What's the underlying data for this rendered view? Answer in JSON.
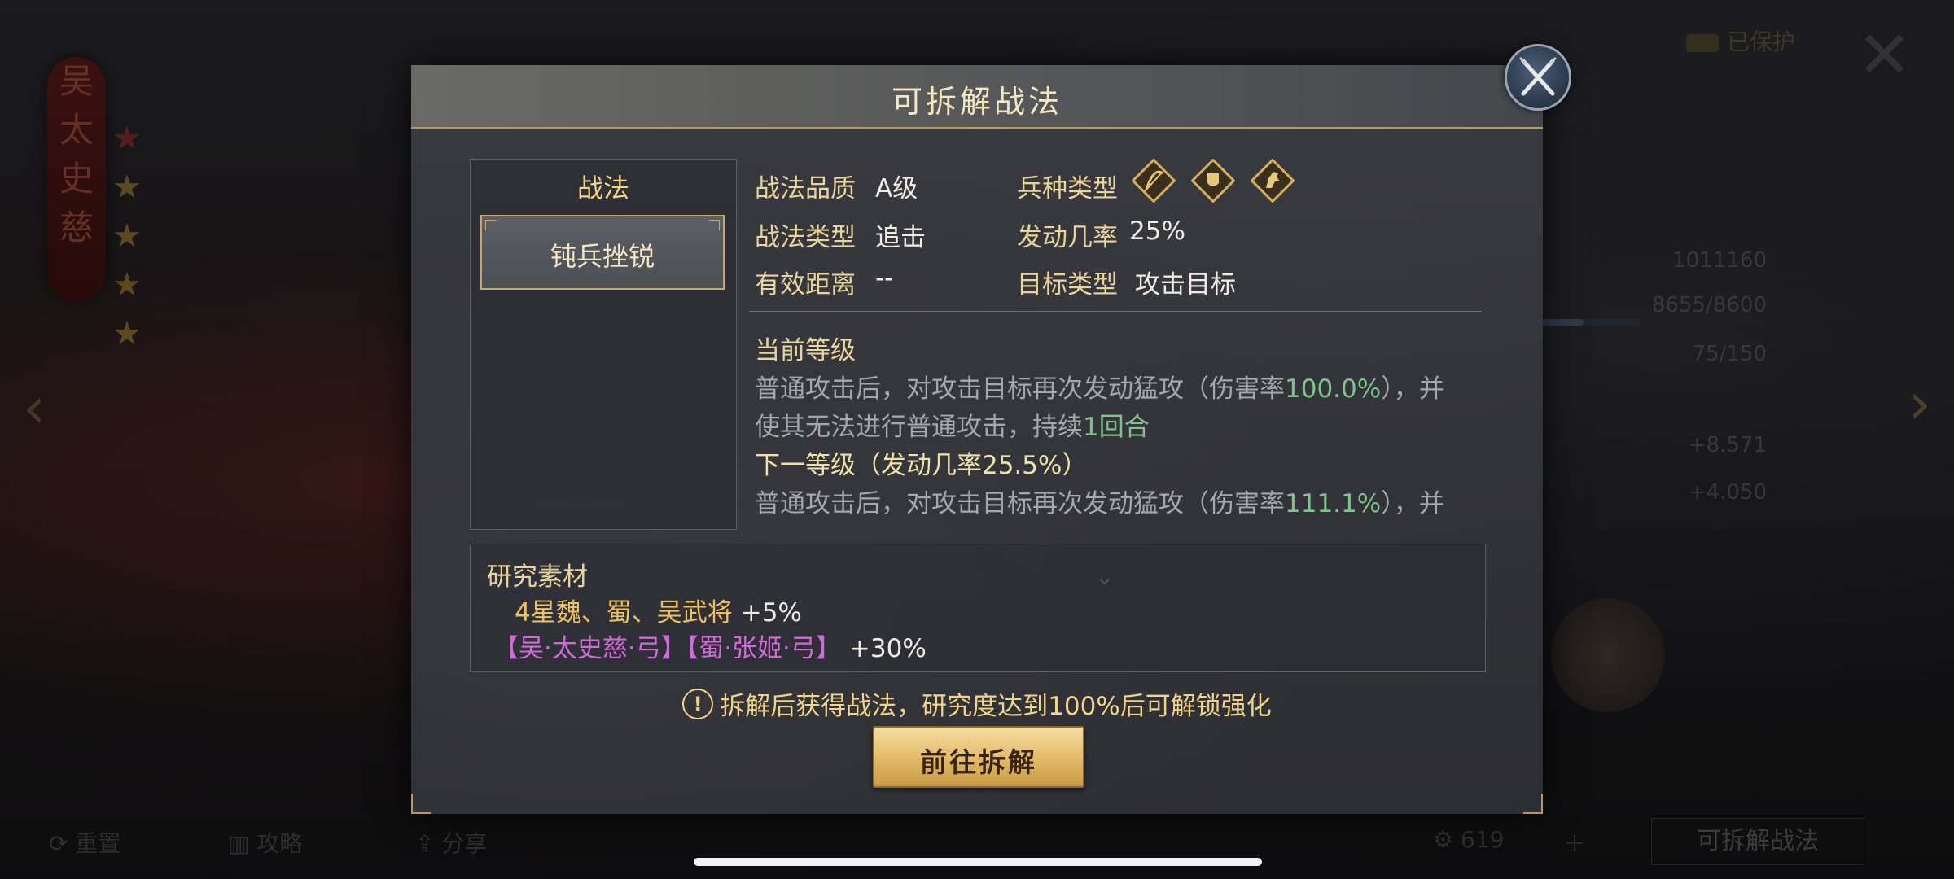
{
  "background": {
    "hero_name_glyphs": [
      "吴",
      "太",
      "史",
      "慈"
    ],
    "protect_badge": "已保护",
    "stats": [
      "1011160",
      "8655/8600",
      "75/150",
      "+8.571",
      "+4.050"
    ],
    "bottom": {
      "reset_label": "重置",
      "strategy_label": "攻略",
      "share_label": "分享",
      "count": "619",
      "right_button": "可拆解战法"
    }
  },
  "dialog": {
    "title": "可拆解战法",
    "tactic_list": {
      "heading": "战法",
      "items": [
        "钝兵挫锐"
      ]
    },
    "info": {
      "quality_label": "战法品质",
      "quality_value": "A级",
      "troop_label": "兵种类型",
      "troop_icons": [
        "archer-icon",
        "shield-icon",
        "cavalry-icon"
      ],
      "type_label": "战法类型",
      "type_value": "追击",
      "trigger_label": "发动几率",
      "trigger_value": "25%",
      "range_label": "有效距离",
      "range_value": "--",
      "target_label": "目标类型",
      "target_value": "攻击目标"
    },
    "description": {
      "current_heading": "当前等级",
      "current_line1_a": "普通攻击后，对攻击目标再次发动猛攻（伤害率",
      "current_line1_hl": "100.0%",
      "current_line1_b": "），并",
      "current_line2_a": "使其无法进行普通攻击，持续",
      "current_line2_hl": "1回合",
      "next_heading": "下一等级（发动几率25.5%）",
      "next_line1_a": "普通攻击后，对攻击目标再次发动猛攻（伤害率",
      "next_line1_hl": "111.1%",
      "next_line1_b": "），并"
    },
    "research": {
      "title": "研究素材",
      "line1_gold": "4星魏、蜀、吴武将",
      "line1_bonus": "+5%",
      "line2_pink": "【吴·太史慈·弓】【蜀·张姬·弓】",
      "line2_bonus": "+30%"
    },
    "notice": "拆解后获得战法，研究度达到100%后可解锁强化",
    "go_button": "前往拆解"
  },
  "colors": {
    "gold_text": "#efd48a",
    "highlight_green": "#7fc38a",
    "pink_text": "#d16ad8",
    "button_gold": "#e6c071"
  }
}
